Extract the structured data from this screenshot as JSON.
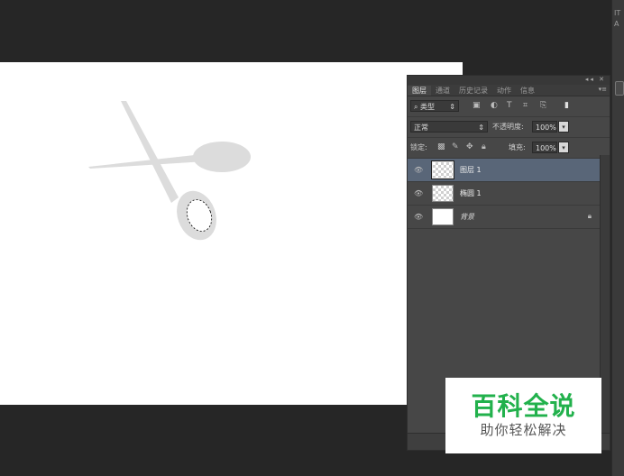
{
  "tabs": [
    "图层",
    "通道",
    "历史记录",
    "动作",
    "信息"
  ],
  "filter": {
    "kind_label": "类型",
    "icons": [
      "image-filter-icon",
      "adjustment-filter-icon",
      "type-filter-icon",
      "shape-filter-icon",
      "smart-object-filter-icon",
      "filter-toggle-icon"
    ]
  },
  "blend": {
    "mode": "正常",
    "opacity_label": "不透明度:",
    "opacity_value": "100%"
  },
  "lock": {
    "label": "锁定:",
    "fill_label": "填充:",
    "fill_value": "100%"
  },
  "layers": [
    {
      "name": "图层 1",
      "selected": true
    },
    {
      "name": "椭圆 1",
      "selected": false
    },
    {
      "name": "背景",
      "selected": false,
      "locked": true
    }
  ],
  "right_strip": {
    "tool_glyphs": [
      "IT",
      "A"
    ]
  },
  "watermark": {
    "title": "百科全说",
    "subtitle": "助你轻松解决"
  },
  "colors": {
    "accent_green": "#22b14c",
    "selected_layer": "#596678",
    "panel_bg": "#474747"
  }
}
